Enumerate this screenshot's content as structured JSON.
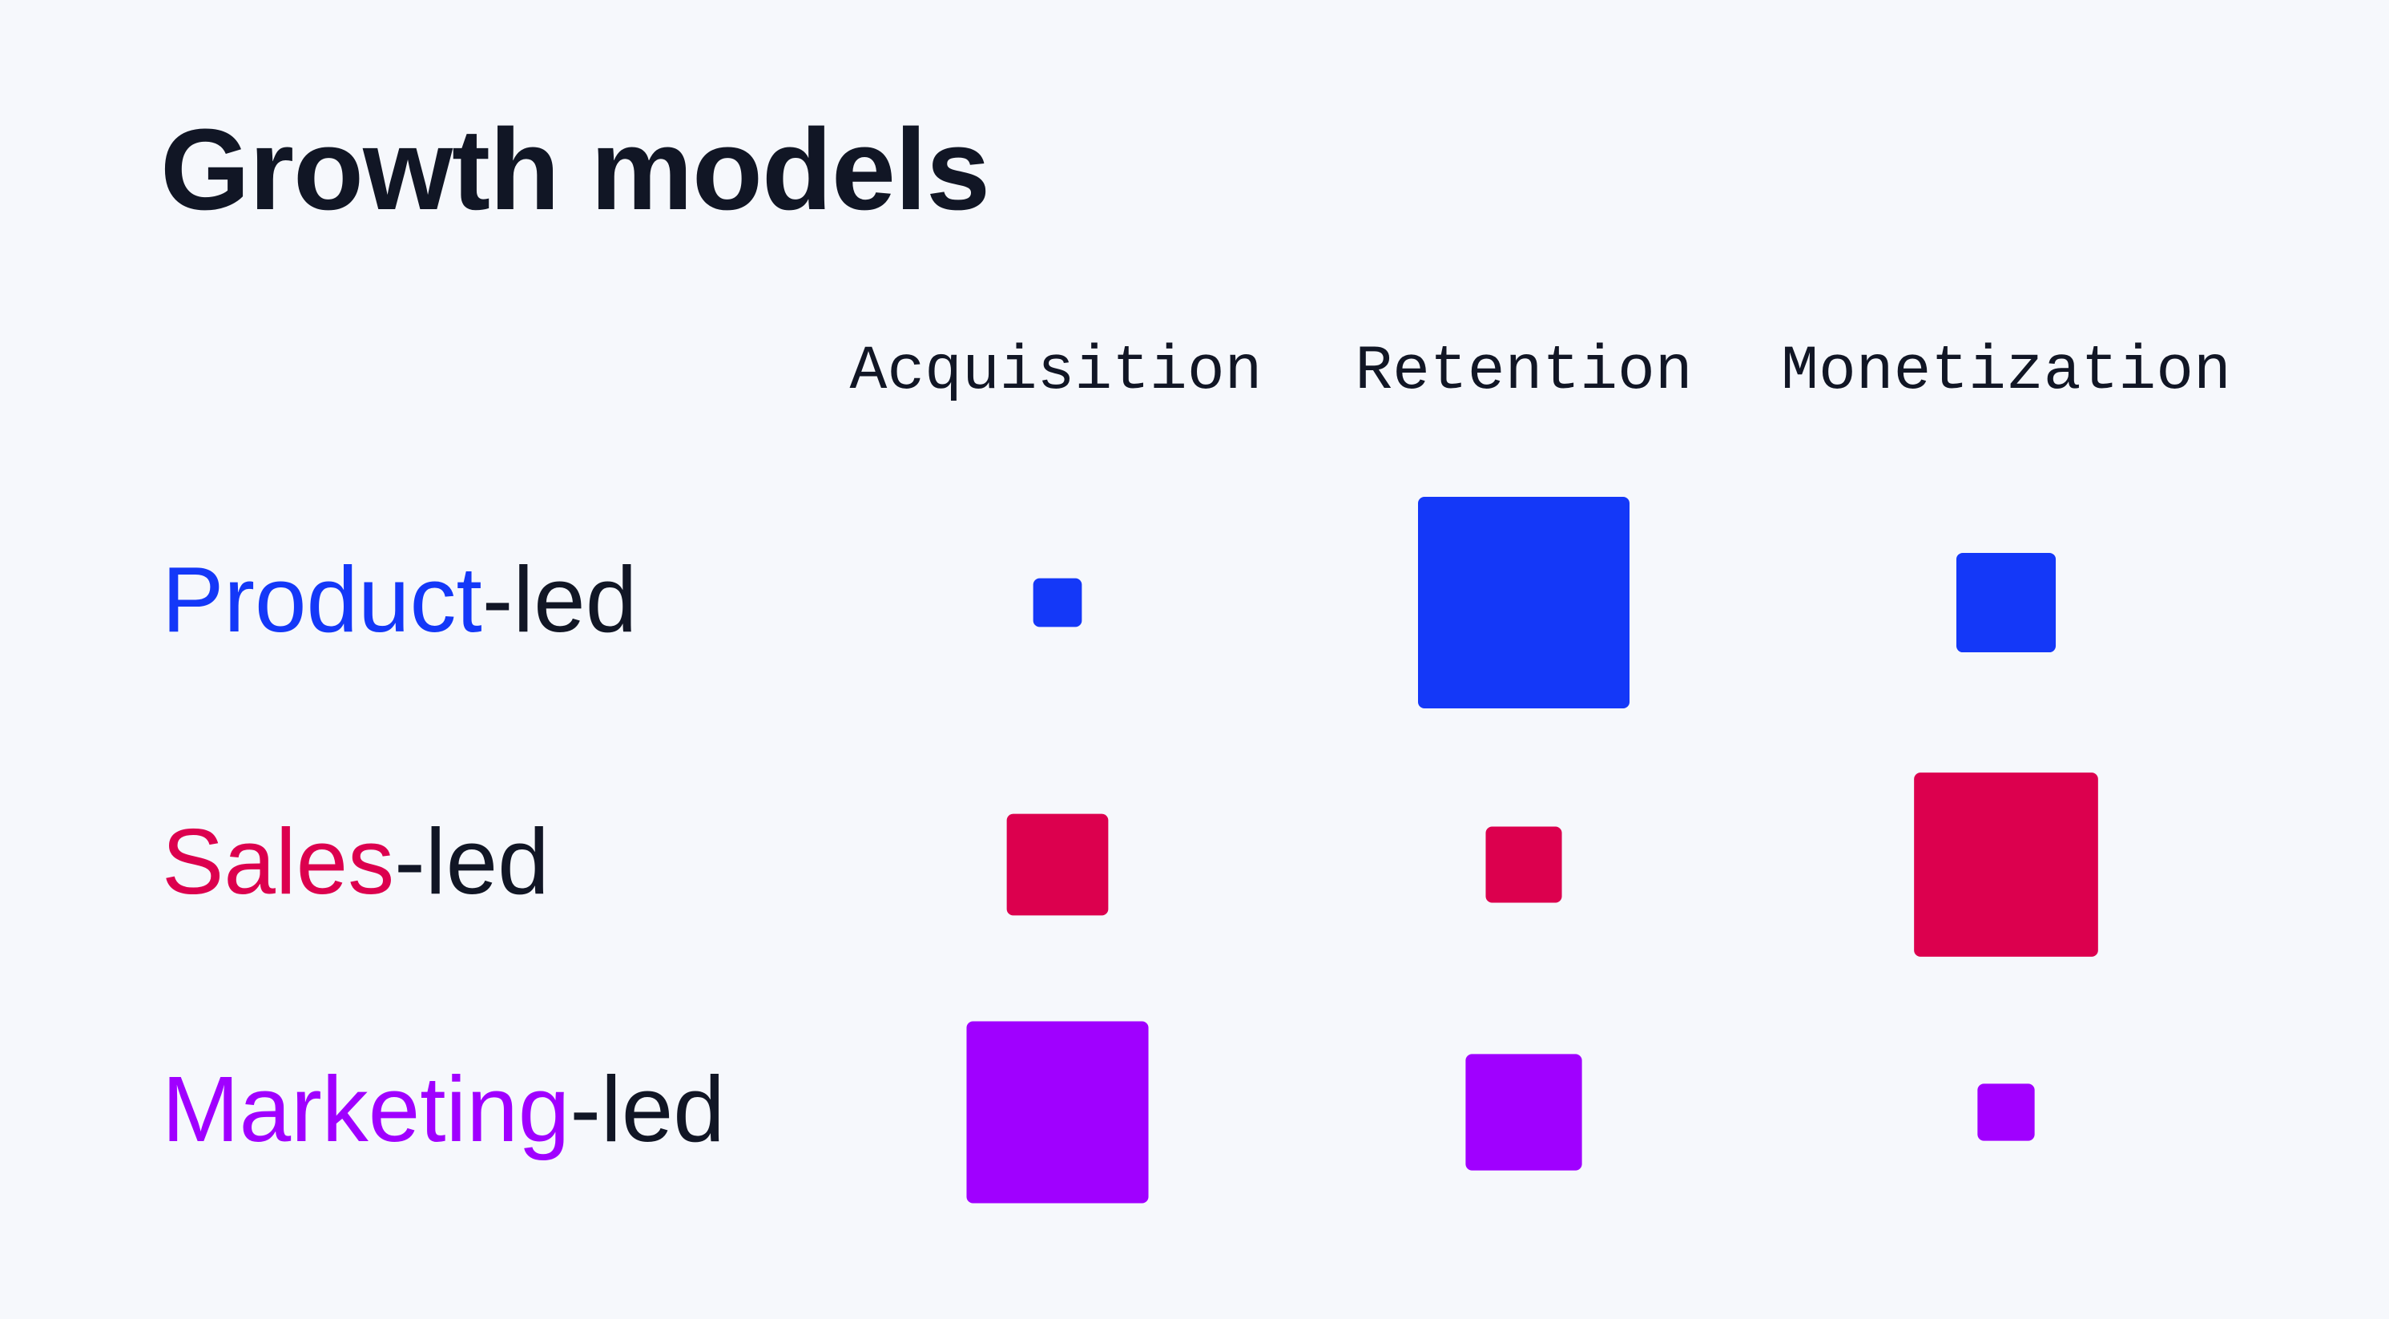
{
  "title": "Growth models",
  "colors": {
    "background": "#F6F8FC",
    "text": "#111625",
    "product": "#1438F8",
    "sales": "#DC004E",
    "marketing": "#A000FF"
  },
  "chart_data": {
    "type": "heatmap",
    "encoding": "square size (relative strength, fraction of largest square)",
    "title": "Growth models",
    "categories": [
      "Acquisition",
      "Retention",
      "Monetization"
    ],
    "series": [
      {
        "name": "Product-led",
        "prefix": "Product",
        "suffix": "-led",
        "color": "#1438F8",
        "values": [
          0.23,
          1.0,
          0.47
        ]
      },
      {
        "name": "Sales-led",
        "prefix": "Sales",
        "suffix": "-led",
        "color": "#DC004E",
        "values": [
          0.48,
          0.36,
          0.87
        ]
      },
      {
        "name": "Marketing-led",
        "prefix": "Marketing",
        "suffix": "-led",
        "color": "#A000FF",
        "values": [
          0.86,
          0.55,
          0.27
        ]
      }
    ],
    "legend": "none",
    "grid": false
  }
}
